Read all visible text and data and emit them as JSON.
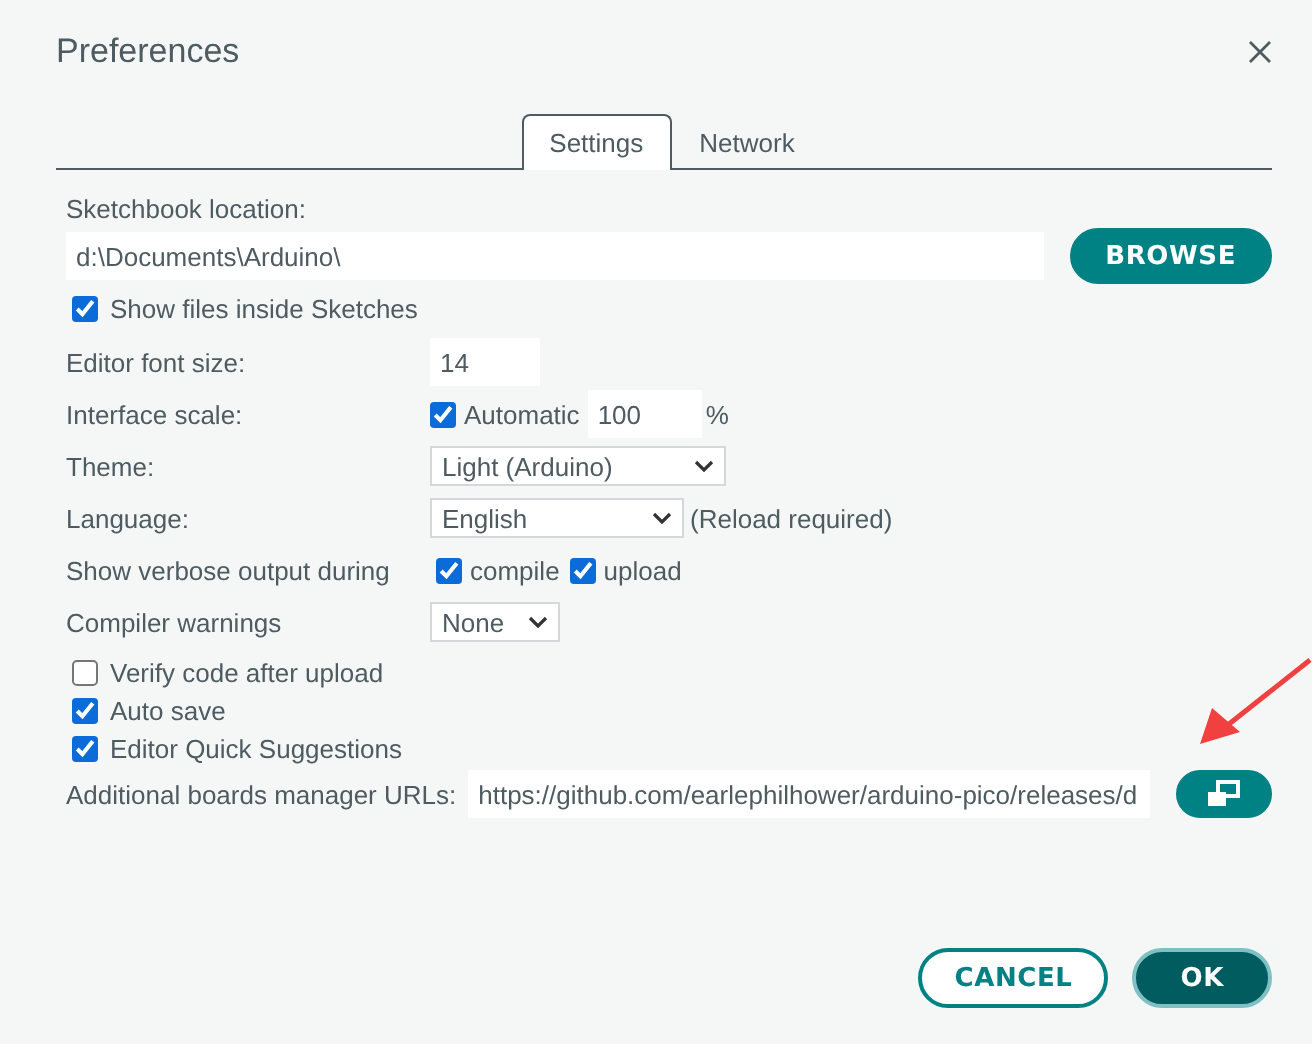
{
  "window": {
    "title": "Preferences"
  },
  "tabs": [
    {
      "label": "Settings",
      "selected": true
    },
    {
      "label": "Network",
      "selected": false
    }
  ],
  "sketchbook": {
    "label": "Sketchbook location:",
    "value": "d:\\Documents\\Arduino\\",
    "button": "BROWSE"
  },
  "show_files": {
    "label": "Show files inside Sketches",
    "checked": true
  },
  "rows": [
    {
      "kind": "number",
      "label": "Editor font size:",
      "value": "14"
    },
    {
      "kind": "scale",
      "label": "Interface scale:",
      "automatic": {
        "label": "Automatic",
        "checked": true
      },
      "value": "100",
      "unit": "%"
    },
    {
      "kind": "select",
      "label": "Theme:",
      "value": "Light (Arduino)"
    },
    {
      "kind": "select",
      "label": "Language:",
      "value": "English",
      "note": "(Reload required)"
    },
    {
      "kind": "checks",
      "label": "Show verbose output during",
      "options": [
        {
          "label": "compile",
          "checked": true
        },
        {
          "label": "upload",
          "checked": true
        }
      ]
    },
    {
      "kind": "select",
      "label": "Compiler warnings",
      "value": "None"
    }
  ],
  "options": [
    {
      "label": "Verify code after upload",
      "checked": false
    },
    {
      "label": "Auto save",
      "checked": true
    },
    {
      "label": "Editor Quick Suggestions",
      "checked": true
    }
  ],
  "urls": {
    "label": "Additional boards manager URLs:",
    "value": "https://github.com/earlephilhower/arduino-pico/releases/d"
  },
  "buttons": [
    {
      "label": "CANCEL",
      "kind": "secondary"
    },
    {
      "label": "OK",
      "kind": "primary"
    }
  ]
}
